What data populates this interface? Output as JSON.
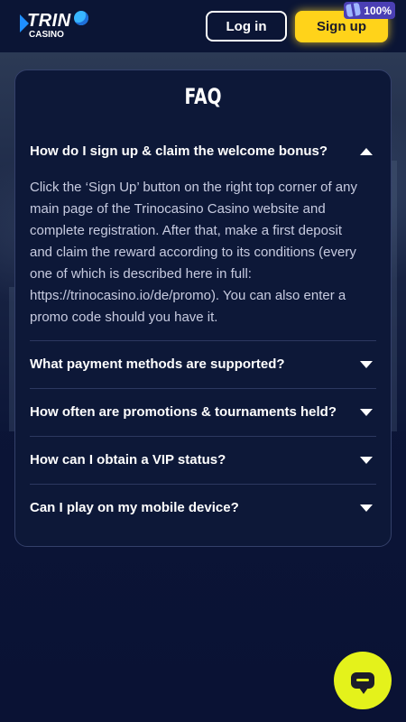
{
  "header": {
    "logo_text": "TRIN",
    "logo_sub": "CASINO",
    "login_label": "Log in",
    "signup_label": "Sign up",
    "badge_text": "100%",
    "badge_icon": "gift-icon"
  },
  "faq": {
    "title": "FAQ",
    "items": [
      {
        "question": "How do I sign up & claim the welcome bonus?",
        "answer": "Click the ‘Sign Up’ button on the right top corner of any main page of the Trinocasino Casino website and complete registration. After that, make a first deposit and claim the reward according to its conditions (every one of which is described here in full: https://trinocasino.io/de/promo). You can also enter a promo code should you have it.",
        "expanded": true
      },
      {
        "question": "What payment methods are supported?",
        "expanded": false
      },
      {
        "question": "How often are promotions & tournaments held?",
        "expanded": false
      },
      {
        "question": "How can I obtain a VIP status?",
        "expanded": false
      },
      {
        "question": "Can I play on my mobile device?",
        "expanded": false
      }
    ]
  },
  "chat": {
    "icon": "chat-icon"
  },
  "colors": {
    "accent": "#ffd31a",
    "chat": "#e4f21b",
    "background": "#0a1234",
    "card": "#0d1838"
  }
}
